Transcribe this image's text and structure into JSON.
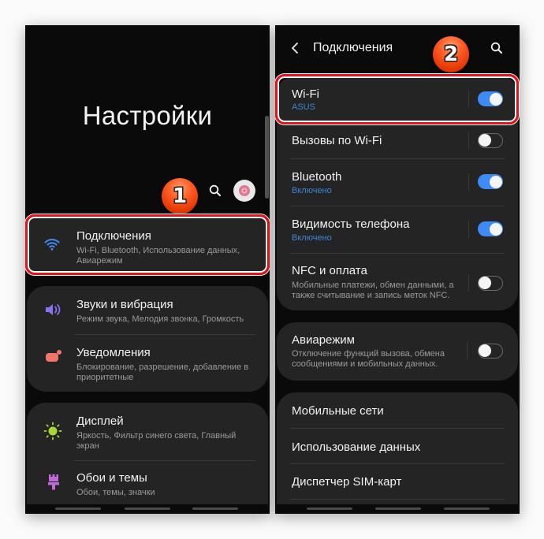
{
  "left_screen": {
    "title": "Настройки",
    "badge": "1",
    "items": [
      {
        "title": "Подключения",
        "subtitle": "Wi-Fi, Bluetooth, Использование данных, Авиарежим",
        "icon": "wifi-icon",
        "icon_color": "#3e8bf5"
      },
      {
        "title": "Звуки и вибрация",
        "subtitle": "Режим звука, Мелодия звонка, Громкость",
        "icon": "volume-icon",
        "icon_color": "#8a72f0"
      },
      {
        "title": "Уведомления",
        "subtitle": "Блокирование, разрешение, добавление в приоритетные",
        "icon": "notification-icon",
        "icon_color": "#f0766a"
      },
      {
        "title": "Дисплей",
        "subtitle": "Яркость, Фильтр синего света, Главный экран",
        "icon": "brightness-icon",
        "icon_color": "#a6d83a"
      },
      {
        "title": "Обои и темы",
        "subtitle": "Обои, темы, значки",
        "icon": "paint-brush-icon",
        "icon_color": "#c06ad8"
      }
    ]
  },
  "right_screen": {
    "title": "Подключения",
    "badge": "2",
    "items": [
      {
        "title": "Wi-Fi",
        "subtitle": "ASUS",
        "toggle": true
      },
      {
        "title": "Вызовы по Wi-Fi",
        "toggle": false
      },
      {
        "title": "Bluetooth",
        "subtitle": "Включено",
        "toggle": true
      },
      {
        "title": "Видимость телефона",
        "subtitle": "Включено",
        "toggle": true
      },
      {
        "title": "NFC и оплата",
        "subtitle": "Мобильные платежи, обмен данными, а также считывание и запись меток NFC.",
        "toggle": false
      },
      {
        "title": "Авиарежим",
        "subtitle": "Отключение функций вызова, обмена сообщениями и мобильных данных.",
        "toggle": false
      },
      {
        "title": "Мобильные сети"
      },
      {
        "title": "Использование данных"
      },
      {
        "title": "Диспетчер SIM-карт"
      }
    ]
  },
  "colors": {
    "accent": "#3e8bf5",
    "highlight": "#e3141b",
    "card": "#242424",
    "background": "#0a0a0a"
  }
}
